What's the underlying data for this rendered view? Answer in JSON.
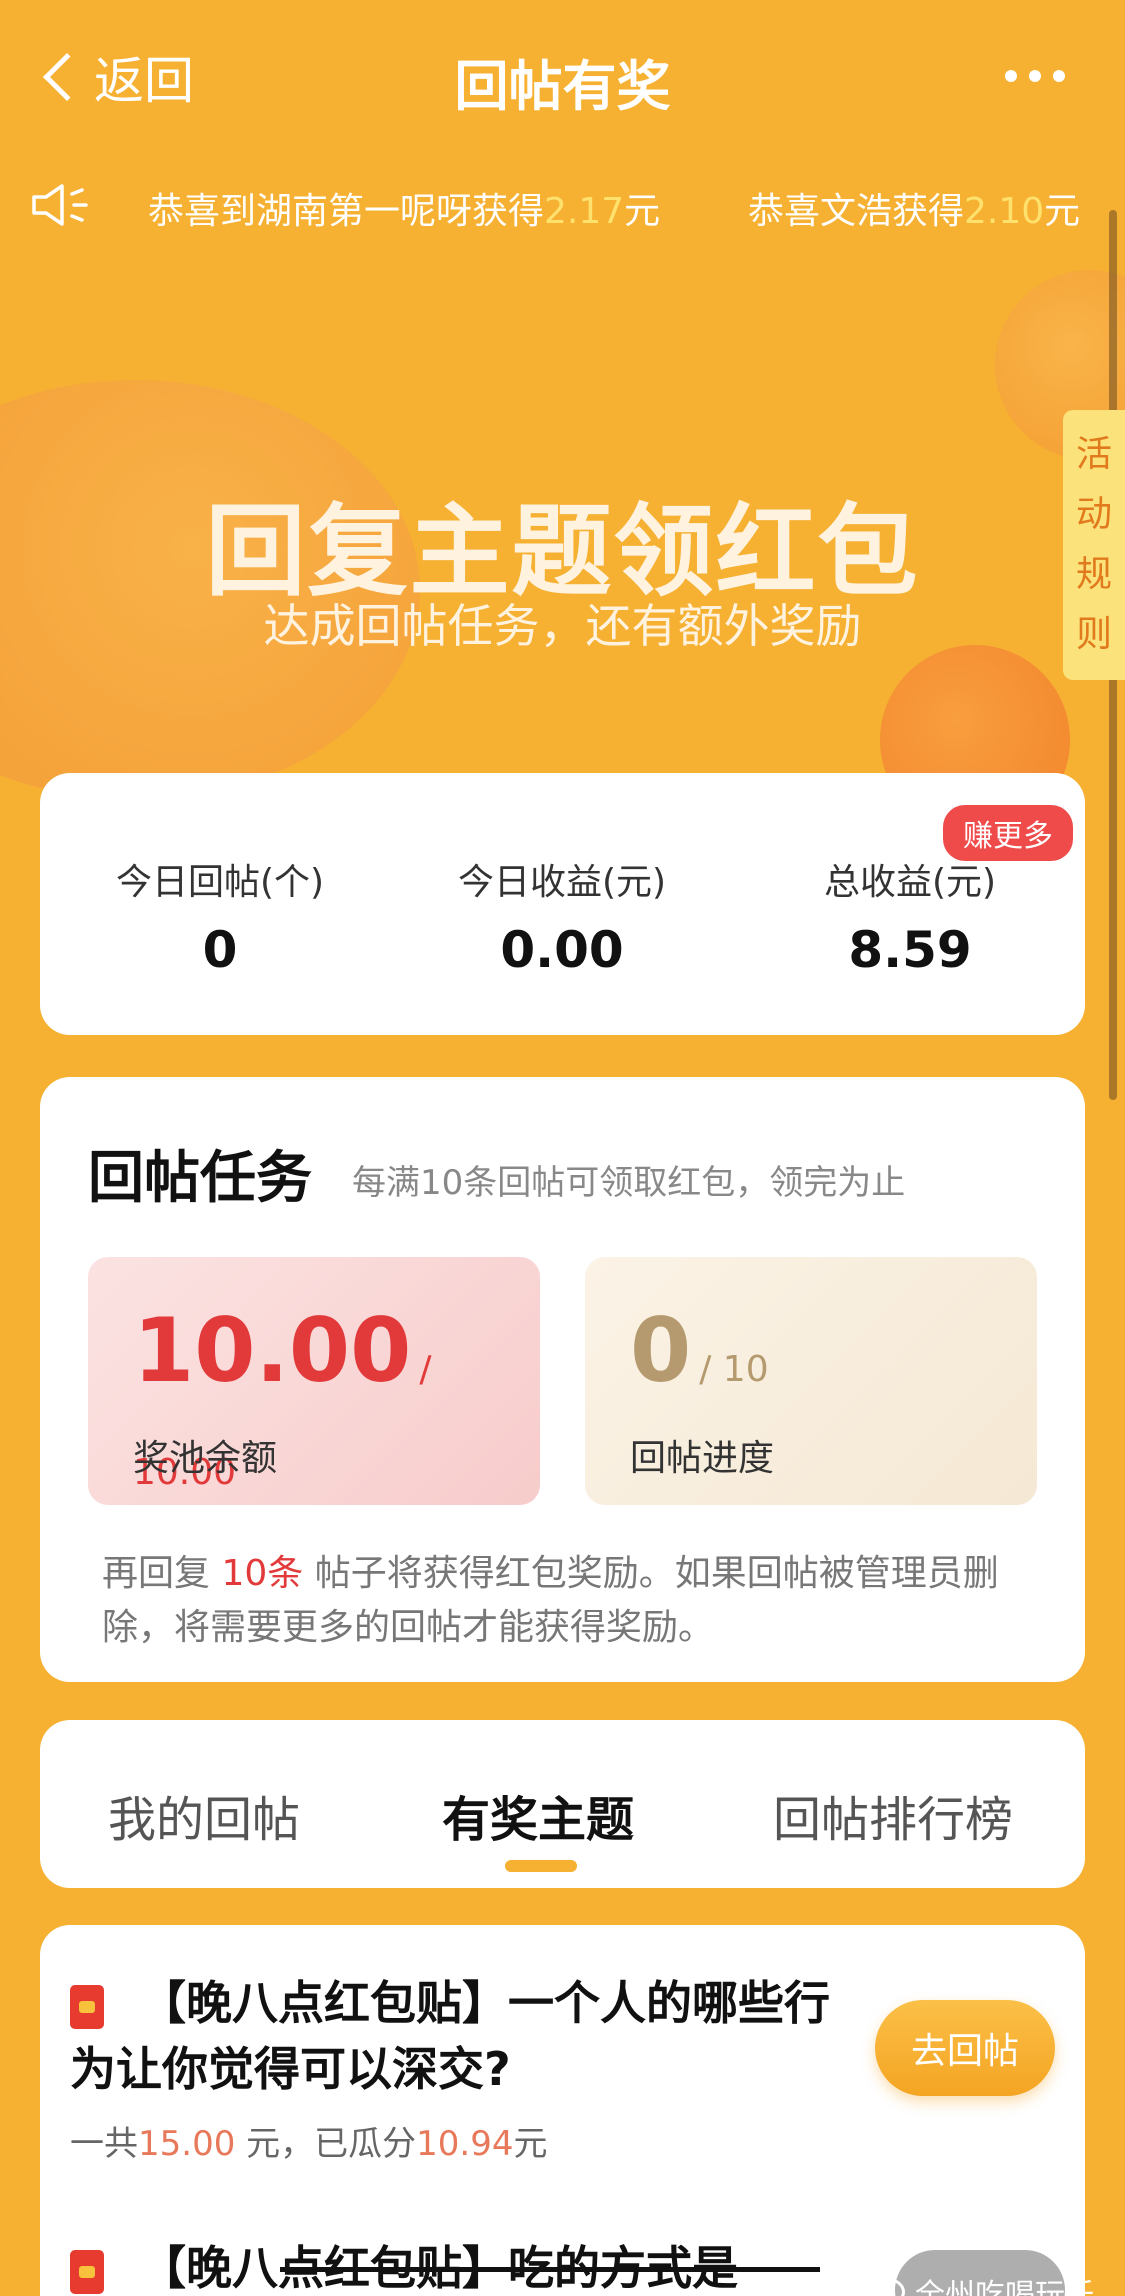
{
  "header": {
    "back_label": "返回",
    "title": "回帖有奖"
  },
  "ticker": {
    "items": [
      {
        "prefix": "恭喜到湖南第一呢呀获得",
        "amount": "2.17",
        "suffix": "元"
      },
      {
        "prefix": "恭喜文浩获得",
        "amount": "2.10",
        "suffix": "元"
      }
    ]
  },
  "hero": {
    "title": "回复主题领红包",
    "subtitle": "达成回帖任务，还有额外奖励"
  },
  "rules_tab": {
    "chars": [
      "活",
      "动",
      "规",
      "则"
    ]
  },
  "stats": {
    "badge": "赚更多",
    "items": [
      {
        "label": "今日回帖(个)",
        "value": "0"
      },
      {
        "label": "今日收益(元)",
        "value": "0.00"
      },
      {
        "label": "总收益(元)",
        "value": "8.59"
      }
    ]
  },
  "task": {
    "title": "回帖任务",
    "desc": "每满10条回帖可领取红包，领完为止",
    "pool": {
      "value": "10.00",
      "total": "/ 10.00",
      "label": "奖池余额"
    },
    "progress": {
      "value": "0",
      "total": "/ 10",
      "label": "回帖进度"
    },
    "note_prefix": "再回复 ",
    "note_highlight": "10条",
    "note_suffix": " 帖子将获得红包奖励。如果回帖被管理员删除，将需要更多的回帖才能获得奖励。"
  },
  "tabs": {
    "items": [
      "我的回帖",
      "有奖主题",
      "回帖排行榜"
    ],
    "active_index": 1
  },
  "posts": [
    {
      "title": "【晚八点红包贴】一个人的哪些行为让你觉得可以深交?",
      "meta_prefix": "一共",
      "total": "15.00",
      "meta_mid": " 元，已瓜分",
      "split": "10.94",
      "meta_suffix": "元",
      "button": "去回帖"
    },
    {
      "title": "【晚八点红包贴】吃的方式是"
    }
  ],
  "watermark": {
    "text": "全州吃喝玩乐"
  }
}
